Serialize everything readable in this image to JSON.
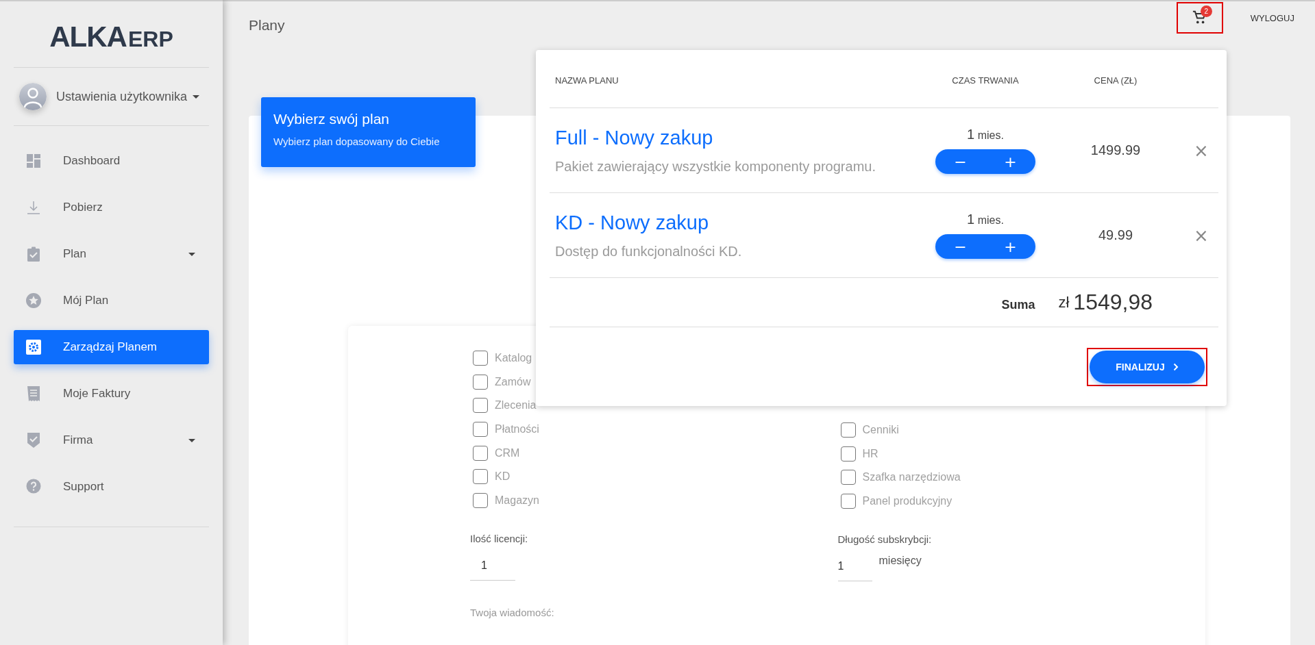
{
  "sidebar": {
    "logo": {
      "main": "ALKA",
      "suffix": "ERP"
    },
    "user": {
      "label": "Ustawienia użytkownika"
    },
    "items": [
      {
        "label": "Dashboard",
        "kind": "dashboard",
        "selected": false,
        "expandable": false
      },
      {
        "label": "Pobierz",
        "kind": "download",
        "selected": false,
        "expandable": false
      },
      {
        "label": "Plan",
        "kind": "plan",
        "selected": false,
        "expandable": true
      },
      {
        "label": "Mój Plan",
        "kind": "myplan",
        "selected": false,
        "expandable": false
      },
      {
        "label": "Zarządzaj Planem",
        "kind": "manage",
        "selected": true,
        "expandable": false
      },
      {
        "label": "Moje Faktury",
        "kind": "invoices",
        "selected": false,
        "expandable": false
      },
      {
        "label": "Firma",
        "kind": "company",
        "selected": false,
        "expandable": true
      },
      {
        "label": "Support",
        "kind": "support",
        "selected": false,
        "expandable": false
      }
    ]
  },
  "header": {
    "title": "Plany",
    "cart": {
      "count": "2",
      "highlighted": true
    },
    "logout": "WYLOGUJ"
  },
  "banner": {
    "title": "Wybierz swój plan",
    "subtitle": "Wybierz plan dopasowany do Ciebie"
  },
  "form": {
    "modules_left": [
      {
        "label": "Katalog",
        "checked": false
      },
      {
        "label": "Zamów",
        "checked": false
      },
      {
        "label": "Zlecenia",
        "checked": false
      },
      {
        "label": "Płatności",
        "checked": false
      },
      {
        "label": "CRM",
        "checked": false
      },
      {
        "label": "KD",
        "checked": false
      },
      {
        "label": "Magazyn",
        "checked": false
      }
    ],
    "modules_right": [
      {
        "label": "Cenniki",
        "checked": false
      },
      {
        "label": "HR",
        "checked": false
      },
      {
        "label": "Szafka narzędziowa",
        "checked": false
      },
      {
        "label": "Panel produkcyjny",
        "checked": false
      }
    ],
    "licenses": {
      "label": "Ilość licencji:",
      "value": "1"
    },
    "subscription": {
      "label": "Długość subskrybcji:",
      "value": "1",
      "unit": "miesięcy"
    },
    "message": {
      "label": "Twoja wiadomość:"
    }
  },
  "cart_popup": {
    "columns": [
      "NAZWA PLANU",
      "CZAS TRWANIA",
      "CENA (ZŁ)"
    ],
    "items": [
      {
        "name": "Full - Nowy zakup",
        "description": "Pakiet zawierający wszystkie komponenty programu.",
        "duration_value": "1",
        "duration_unit": "mies.",
        "minus": "−",
        "plus": "+",
        "price": "1499.99",
        "remove": "×"
      },
      {
        "name": "KD - Nowy zakup",
        "description": "Dostęp do funkcjonalności KD.",
        "duration_value": "1",
        "duration_unit": "mies.",
        "minus": "−",
        "plus": "+",
        "price": "49.99",
        "remove": "×"
      }
    ],
    "total": {
      "label": "Suma",
      "currency": "zł",
      "amount": "1549,98"
    },
    "finalize": {
      "label": "FINALIZUJ",
      "highlighted": true
    }
  }
}
